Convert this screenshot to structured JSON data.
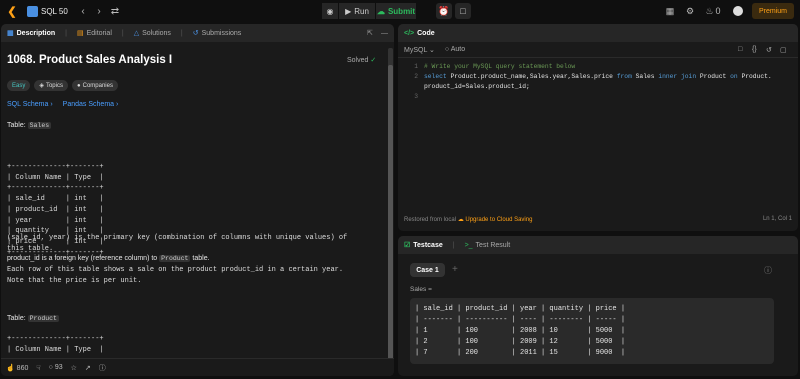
{
  "topbar": {
    "list_title": "SQL 50",
    "run": "Run",
    "submit": "Submit",
    "fire_count": "0",
    "premium": "Premium"
  },
  "left": {
    "tabs": [
      {
        "label": "Description"
      },
      {
        "label": "Editorial"
      },
      {
        "label": "Solutions"
      },
      {
        "label": "Submissions"
      }
    ],
    "title": "1068. Product Sales Analysis I",
    "solved": "Solved",
    "chips": {
      "difficulty": "Easy",
      "topics": "Topics",
      "companies": "Companies"
    },
    "links": {
      "sql": "SQL Schema",
      "pandas": "Pandas Schema"
    },
    "table_label": "Table:",
    "table1": "Sales",
    "schema1": "+-------------+-------+\n| Column Name | Type  |\n+-------------+-------+\n| sale_id     | int   |\n| product_id  | int   |\n| year        | int   |\n| quantity    | int   |\n| price       | int   |\n+-------------+-------+",
    "desc1": "(sale_id, year) is the primary key (combination of columns with unique values) of\nthis table.",
    "desc2a": "product_id is a foreign key (reference column) to",
    "desc2b": "table.",
    "desc2_ref": "Product",
    "desc3": "Each row of this table shows a sale on the product product_id in a certain year.\nNote that the price is per unit.",
    "table2": "Product",
    "schema2": "+-------------+-------+\n| Column Name | Type  |",
    "footer": {
      "likes": "860",
      "comments": "93"
    }
  },
  "code": {
    "tab": "Code",
    "lang": "MySQL",
    "auto": "Auto",
    "lines": [
      {
        "n": "1",
        "text": "# Write your MySQL query statement below"
      },
      {
        "n": "2",
        "pre": "select Product.product_name,Sales.year,Sales.price ",
        "kw1": "from",
        "mid": " Sales ",
        "kw2": "inner join",
        "post": " Product on Product.",
        "cont": "product_id=Sales.product_id;"
      },
      {
        "n": "3",
        "text": ""
      }
    ],
    "restored": "Restored from local",
    "upgrade": "Upgrade to Cloud Saving",
    "position": "Ln 1, Col 1"
  },
  "testcase": {
    "tab1": "Testcase",
    "tab2": "Test Result",
    "case": "Case 1",
    "label": "Sales =",
    "table": "| sale_id | product_id | year | quantity | price |\n| ------- | ---------- | ---- | -------- | ----- |\n| 1       | 100        | 2008 | 10       | 5000  |\n| 2       | 100        | 2009 | 12       | 5000  |\n| 7       | 200        | 2011 | 15       | 9000  |"
  }
}
